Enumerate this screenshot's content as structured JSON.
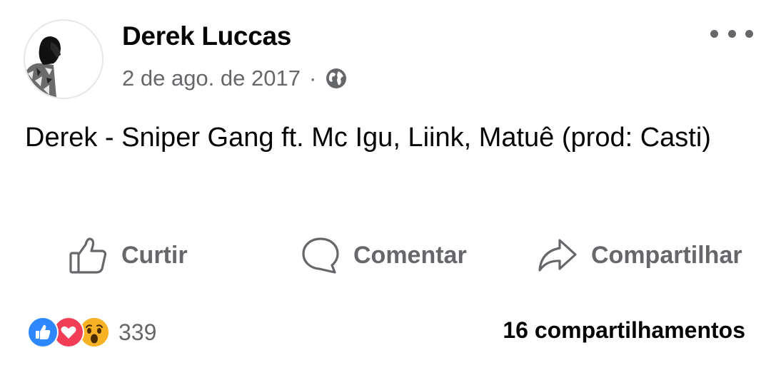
{
  "post": {
    "author_name": "Derek Luccas",
    "date": "2 de ago. de 2017",
    "separator": "·",
    "privacy_icon": "globe-icon",
    "more_icon": "more-horizontal-icon",
    "text": "Derek - Sniper Gang ft. Mc Igu, Liink, Matuê (prod: Casti)"
  },
  "actions": {
    "like": {
      "label": "Curtir",
      "icon": "thumbs-up-outline-icon"
    },
    "comment": {
      "label": "Comentar",
      "icon": "speech-bubble-icon"
    },
    "share": {
      "label": "Compartilhar",
      "icon": "share-arrow-icon"
    }
  },
  "stats": {
    "reactions": [
      "like",
      "love",
      "wow"
    ],
    "reaction_count": "339",
    "shares": "16 compartilhamentos"
  },
  "colors": {
    "text_primary": "#050505",
    "text_secondary": "#65676b",
    "like_blue": "#2d88ff",
    "love_red": "#f33e58",
    "wow_yellow": "#f7b125"
  }
}
